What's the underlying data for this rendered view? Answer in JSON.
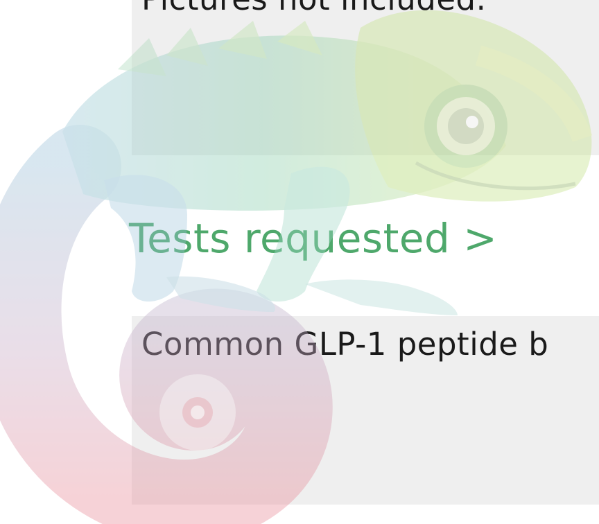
{
  "content": {
    "top_text": "Pictures not included.",
    "section_heading": "Tests requested >",
    "bottom_text": "Common GLP-1 peptide b"
  },
  "icons": {
    "watermark": "chameleon-mascot-icon"
  },
  "colors": {
    "heading": "#4ea86b",
    "panel": "#efefef",
    "text": "#1a1a1a"
  }
}
